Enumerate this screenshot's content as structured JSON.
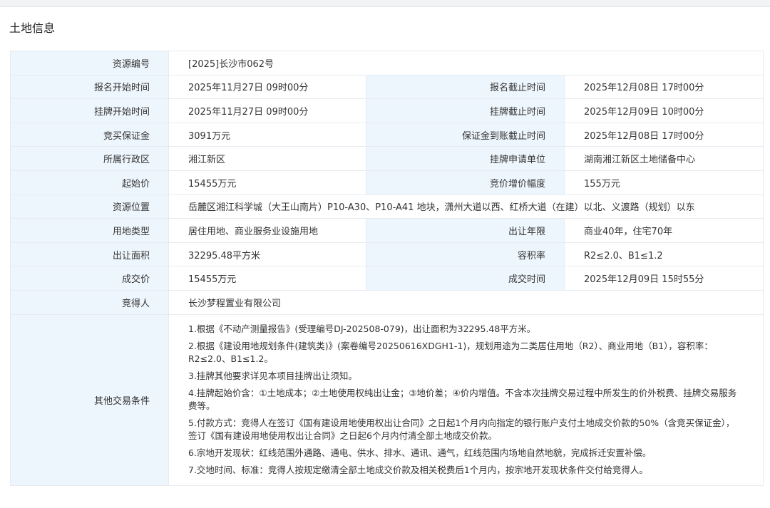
{
  "section": {
    "title": "土地信息"
  },
  "rows": {
    "resource_no": {
      "label": "资源编号",
      "value": "[2025]长沙市062号"
    },
    "signup_start": {
      "label": "报名开始时间",
      "value": "2025年11月27日 09时00分"
    },
    "signup_end": {
      "label": "报名截止时间",
      "value": "2025年12月08日 17时00分"
    },
    "listing_start": {
      "label": "挂牌开始时间",
      "value": "2025年11月27日 09时00分"
    },
    "listing_end": {
      "label": "挂牌截止时间",
      "value": "2025年12月09日 10时00分"
    },
    "deposit": {
      "label": "竞买保证金",
      "value": "3091万元"
    },
    "deposit_deadline": {
      "label": "保证金到账截止时间",
      "value": "2025年12月08日 17时00分"
    },
    "district": {
      "label": "所属行政区",
      "value": "湘江新区"
    },
    "applicant_unit": {
      "label": "挂牌申请单位",
      "value": "湖南湘江新区土地储备中心"
    },
    "start_price": {
      "label": "起始价",
      "value": "15455万元"
    },
    "bid_increment": {
      "label": "竞价增价幅度",
      "value": "155万元"
    },
    "location": {
      "label": "资源位置",
      "value": "岳麓区湘江科学城（大王山南片）P10-A30、P10-A41 地块，潇州大道以西、红桥大道（在建）以北、义渡路（规划）以东"
    },
    "land_use": {
      "label": "用地类型",
      "value": "居住用地、商业服务业设施用地"
    },
    "term": {
      "label": "出让年限",
      "value": "商业40年，住宅70年"
    },
    "area": {
      "label": "出让面积",
      "value": "32295.48平方米"
    },
    "far": {
      "label": "容积率",
      "value": "R2≤2.0、B1≤1.2"
    },
    "deal_price": {
      "label": "成交价",
      "value": "15455万元"
    },
    "deal_time": {
      "label": "成交时间",
      "value": "2025年12月09日 15时55分"
    },
    "winner": {
      "label": "竞得人",
      "value": "长沙梦程置业有限公司"
    },
    "other_conditions": {
      "label": "其他交易条件",
      "items": [
        "1.根据《不动产测量报告》(受理编号DJ-202508-079)，出让面积为32295.48平方米。",
        "2.根据《建设用地规划条件(建筑类)》(案卷编号20250616XDGH1-1)，规划用途为二类居住用地（R2）、商业用地（B1），容积率：R2≤2.0、B1≤1.2。",
        "3.挂牌其他要求详见本项目挂牌出让须知。",
        "4.挂牌起始价含：①土地成本；②土地使用权纯出让金；③地价差；④价内增值。不含本次挂牌交易过程中所发生的价外税费、挂牌交易服务费等。",
        "5.付款方式：竞得人在签订《国有建设用地使用权出让合同》之日起1个月内向指定的银行账户支付土地成交价款的50%（含竞买保证金），签订《国有建设用地使用权出让合同》之日起6个月内付清全部土地成交价款。",
        "6.宗地开发现状：红线范围外通路、通电、供水、排水、通讯、通气，红线范围内场地自然地貌，完成拆迁安置补偿。",
        "7.交地时间、标准：竞得人按规定缴清全部土地成交价款及相关税费后1个月内，按宗地开发现状条件交付给竞得人。"
      ]
    }
  }
}
